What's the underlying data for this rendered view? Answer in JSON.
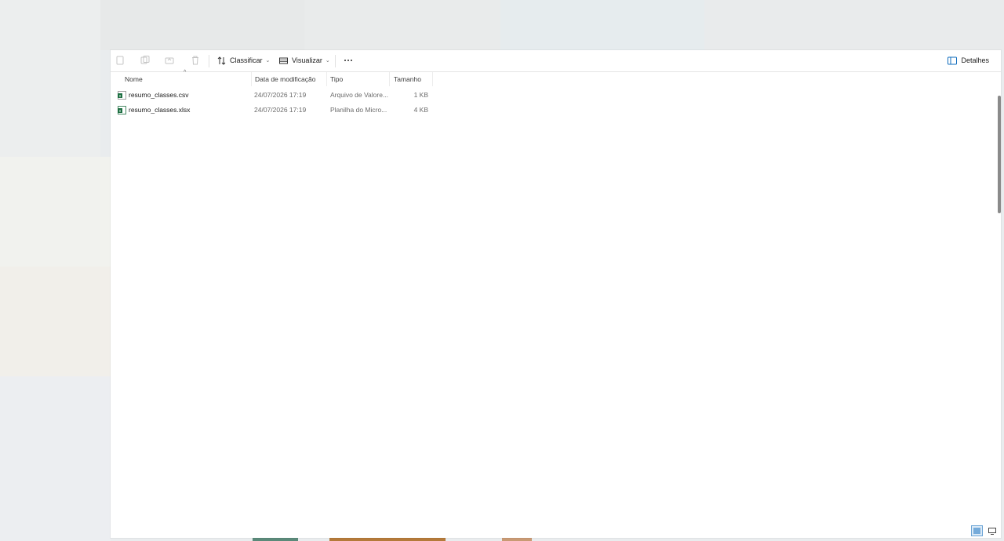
{
  "toolbar": {
    "sort_label": "Classificar",
    "view_label": "Visualizar",
    "details_label": "Detalhes",
    "icons": [
      "cut-icon",
      "copy-icon",
      "share-icon",
      "delete-icon",
      "sort-icon",
      "view-icon",
      "more-icon",
      "details-pane-icon"
    ]
  },
  "columns": {
    "name": "Nome",
    "modified": "Data de modificação",
    "type": "Tipo",
    "size": "Tamanho"
  },
  "files": [
    {
      "name": "resumo_classes.csv",
      "modified": "24/07/2026 17:19",
      "type": "Arquivo de Valore...",
      "size": "1 KB"
    },
    {
      "name": "resumo_classes.xlsx",
      "modified": "24/07/2026 17:19",
      "type": "Planilha do Micro...",
      "size": "4 KB"
    }
  ],
  "colors": {
    "accent": "#0f6cbd",
    "excel_green": "#1d6f42",
    "window_bg": "#ffffff"
  }
}
